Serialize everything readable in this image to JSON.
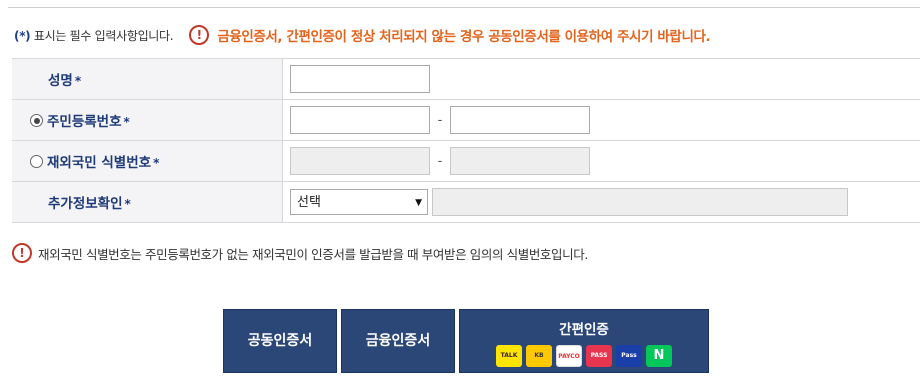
{
  "notice": {
    "required_prefix": "(",
    "required_star": "*",
    "required_suffix": ")",
    "required_text": "표시는 필수 입력사항입니다.",
    "warning_icon": "!",
    "warning_text": "금융인증서, 간편인증이 정상 처리되지 않는 경우 공동인증서를 이용하여 주시기 바랍니다."
  },
  "form": {
    "star": "*",
    "dash": "-",
    "name_label": "성명",
    "rrn_label": "주민등록번호",
    "foreign_label": "재외국민 식별번호",
    "extra_label": "추가정보확인",
    "select_value": "선택"
  },
  "footnote": {
    "icon": "!",
    "text": "재외국민 식별번호는 주민등록번호가 없는 재외국민이 인증서를 발급받을 때 부여받은 임의의 식별번호입니다."
  },
  "buttons": {
    "joint_cert": "공동인증서",
    "financial_cert": "금융인증서",
    "simple_auth": "간편인증"
  },
  "logos": {
    "talk": "TALK",
    "kb": "KB",
    "payco": "PAYCO",
    "pass": "PASS",
    "samsung_pass": "Pass",
    "naver": "N"
  },
  "colors": {
    "accent_navy": "#2b4778",
    "warning_orange": "#e4641e",
    "warning_red": "#c0392b"
  }
}
